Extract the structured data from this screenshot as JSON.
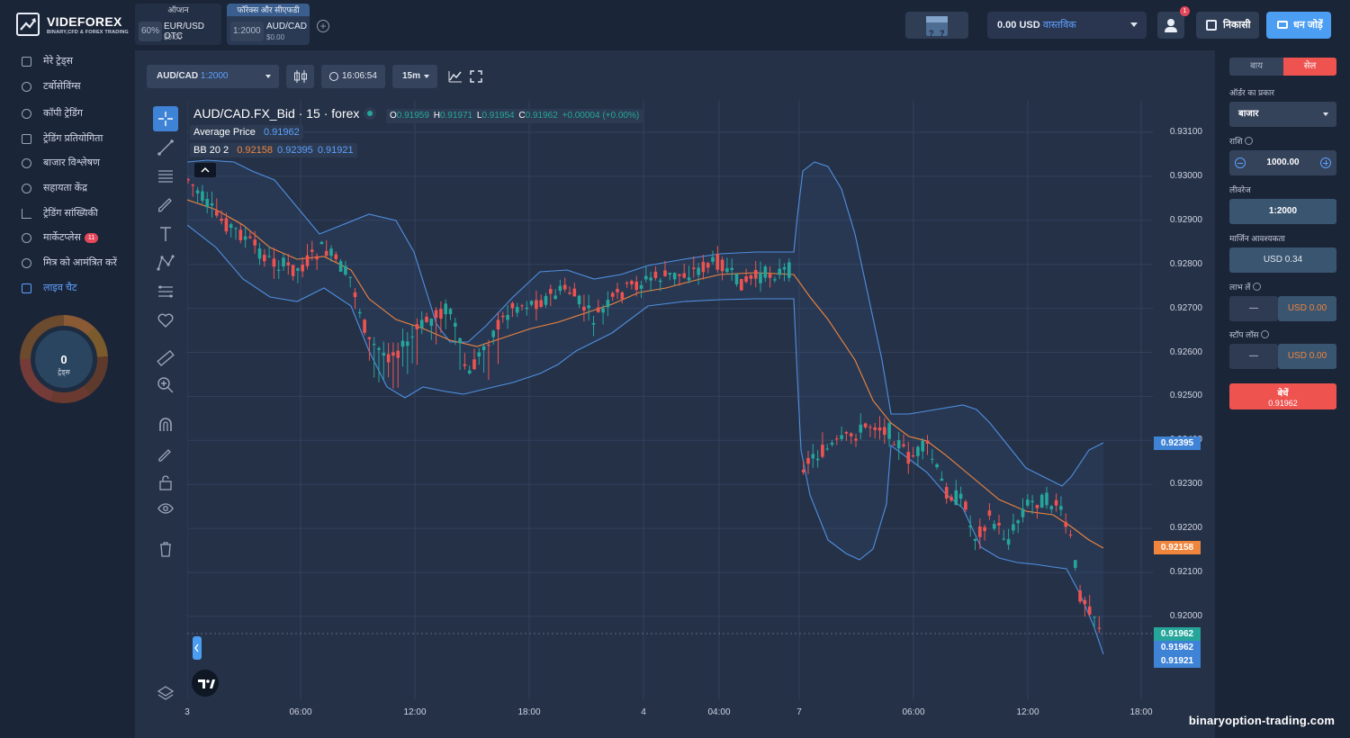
{
  "brand": {
    "name": "VIDEFOREX",
    "tagline": "BINARY,CFD & FOREX TRADING"
  },
  "asset_tabs": [
    {
      "header": "ऑप्शन",
      "pill": "60%",
      "name": "EUR/USD OTC",
      "price": "$0.00"
    },
    {
      "header": "फॉरेक्स और सीएफडी",
      "pill": "1:2000",
      "name": "AUD/CAD",
      "price": "$0.00"
    }
  ],
  "header": {
    "balance_amount": "0.00 USD",
    "account_type": "वास्तविक",
    "notification_count": "1",
    "withdraw_label": "निकासी",
    "deposit_label": "धन जोड़ें",
    "gift_q1": "?",
    "gift_q2": "?"
  },
  "sidebar": {
    "items": [
      {
        "label": "मेरे ट्रेड्स"
      },
      {
        "label": "टर्बोसेविंग्स"
      },
      {
        "label": "कॉपी ट्रेडिंग"
      },
      {
        "label": "ट्रेडिंग प्रतियोगिता"
      },
      {
        "label": "बाजार विश्लेषण"
      },
      {
        "label": "सहायता केंद्र"
      },
      {
        "label": "ट्रेडिंग सांख्यिकी"
      },
      {
        "label": "मार्केटप्लेस",
        "badge": "11"
      },
      {
        "label": "मित्र को आमंत्रित करें"
      },
      {
        "label": "लाइव चैट"
      }
    ],
    "trades_count": "0",
    "trades_label": "ट्रेड्स"
  },
  "toolbar": {
    "symbol": "AUD/CAD",
    "leverage": "1:2000",
    "time": "16:06:54",
    "interval": "15m"
  },
  "legend": {
    "title": "AUD/CAD.FX_Bid · 15 · forex",
    "o_label": "O",
    "o": "0.91959",
    "h_label": "H",
    "h": "0.91971",
    "l_label": "L",
    "l": "0.91954",
    "c_label": "C",
    "c": "0.91962",
    "change": "+0.00004 (+0.00%)",
    "avg_label": "Average Price",
    "avg": "0.91962",
    "bb_label": "BB 20 2",
    "bb_mid": "0.92158",
    "bb_up": "0.92395",
    "bb_low": "0.91921"
  },
  "colors": {
    "up": "#26a69a",
    "down": "#ef5350",
    "bb_band": "#4f8fe0",
    "bb_basis": "#f0853d",
    "panel": "#253147",
    "accent": "#4c9ef2"
  },
  "chart_data": {
    "type": "candlestick",
    "yticks": [
      "0.93100",
      "0.93000",
      "0.92900",
      "0.92800",
      "0.92700",
      "0.92600",
      "0.92500",
      "0.92400",
      "0.92300",
      "0.92200",
      "0.92100",
      "0.92000"
    ],
    "ylim": [
      0.9193,
      0.9314
    ],
    "xticks": [
      "3",
      "06:00",
      "12:00",
      "18:00",
      "4",
      "04:00",
      "7",
      "06:00",
      "12:00",
      "18:00"
    ],
    "price_tags": [
      {
        "value": "0.92395",
        "color": "#3f83d6"
      },
      {
        "value": "0.92158",
        "color": "#f0853d"
      },
      {
        "value": "0.91962",
        "color": "#26a69a"
      },
      {
        "value": "0.91962",
        "color": "#3f83d6"
      },
      {
        "value": "0.91921",
        "color": "#3f83d6"
      }
    ],
    "indicators": [
      "Bollinger Bands 20 2",
      "Average Price"
    ]
  },
  "trade": {
    "buy_label": "बाय",
    "sell_label": "सेल",
    "order_type_label": "ऑर्डर का प्रकार",
    "order_type": "बाजार",
    "amount_label": "राशि",
    "amount": "1000.00",
    "leverage_label": "लीवरेज",
    "leverage": "1:2000",
    "margin_label": "मार्जिन आवश्यकता",
    "margin": "USD 0.34",
    "tp_label": "लाभ लें",
    "tp_value": "USD 0.00",
    "sl_label": "स्टॉप लॉस",
    "sl_value": "USD 0.00",
    "dash": "—",
    "action_label": "बेचें",
    "action_price": "0.91962"
  },
  "watermark": "binaryoption-trading.com"
}
